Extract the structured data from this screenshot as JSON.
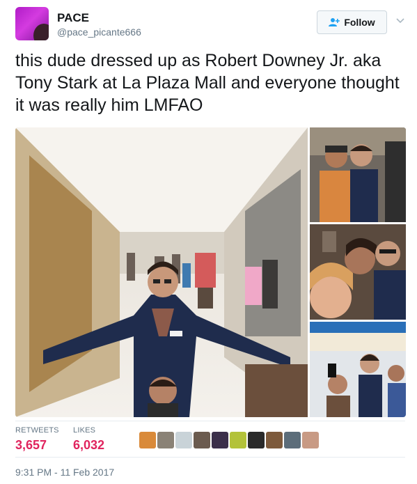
{
  "user": {
    "name": "PACE",
    "handle": "@pace_picante666"
  },
  "follow_button": {
    "label": "Follow",
    "icon": "add-user-icon"
  },
  "tweet": {
    "text": "this dude dressed up as Robert Downey Jr. aka Tony Stark at La Plaza Mall and everyone thought it was really him LMFAO"
  },
  "media": {
    "main": "mall-photo",
    "thumbnails": [
      "selfie-photo-1",
      "selfie-photo-2",
      "selfie-photo-3"
    ]
  },
  "stats": {
    "retweets_label": "RETWEETS",
    "retweets_value": "3,657",
    "likes_label": "LIKES",
    "likes_value": "6,032"
  },
  "likers": [
    {
      "color": "#d98a3a"
    },
    {
      "color": "#8a8276"
    },
    {
      "color": "#c9d3d8"
    },
    {
      "color": "#6b5b4f"
    },
    {
      "color": "#3b2f4a"
    },
    {
      "color": "#b3c23a"
    },
    {
      "color": "#2a2a2a"
    },
    {
      "color": "#7d5a3c"
    },
    {
      "color": "#5c6d7a"
    },
    {
      "color": "#c89a84"
    }
  ],
  "timestamp": "9:31 PM - 11 Feb 2017",
  "colors": {
    "text": "#14171a",
    "muted": "#657786",
    "like_red": "#e0245e",
    "follow_blue": "#1da1f2"
  }
}
